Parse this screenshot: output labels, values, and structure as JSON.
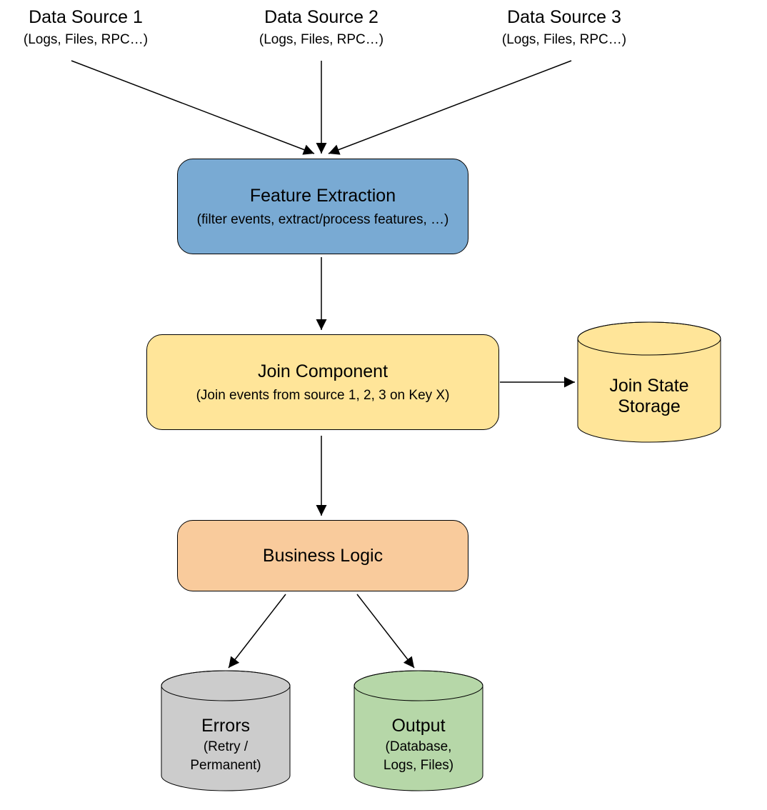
{
  "sources": [
    {
      "title": "Data Source 1",
      "sub": "(Logs, Files, RPC…)"
    },
    {
      "title": "Data Source 2",
      "sub": "(Logs, Files, RPC…)"
    },
    {
      "title": "Data Source 3",
      "sub": "(Logs, Files, RPC…)"
    }
  ],
  "feature": {
    "title": "Feature Extraction",
    "sub": "(filter events, extract/process features, …)"
  },
  "join": {
    "title": "Join Component",
    "sub": "(Join events from source 1, 2, 3 on Key X)"
  },
  "joinStorage": {
    "line1": "Join State",
    "line2": "Storage"
  },
  "business": {
    "title": "Business Logic"
  },
  "errors": {
    "title": "Errors",
    "sub1": "(Retry /",
    "sub2": "Permanent)"
  },
  "output": {
    "title": "Output",
    "sub1": "(Database,",
    "sub2": "Logs, Files)"
  },
  "colors": {
    "feature": "#79aad3",
    "join": "#ffe599",
    "business": "#f9cb9c",
    "storage": "#ffe599",
    "errors": "#cccccc",
    "output": "#b6d7a8"
  }
}
